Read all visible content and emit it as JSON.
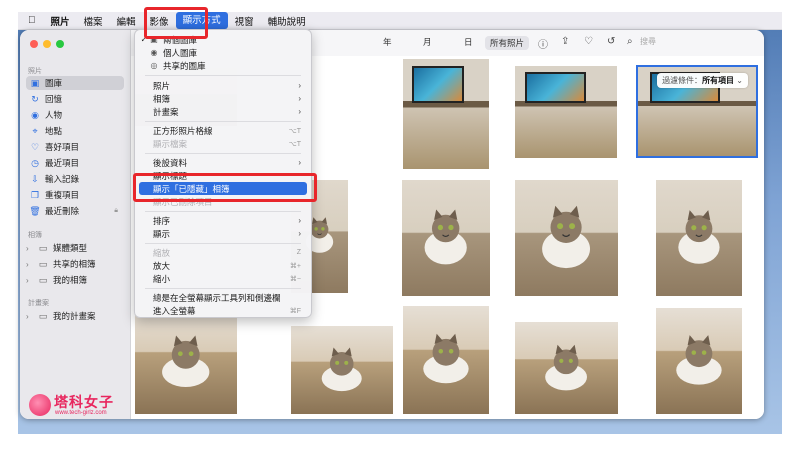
{
  "menubar": {
    "apple_icon": "apple-logo",
    "items": [
      "照片",
      "檔案",
      "編輯",
      "影像",
      "顯示方式",
      "視窗",
      "輔助說明"
    ],
    "active_item": "顯示方式"
  },
  "sidebar": {
    "section_photos": "照片",
    "items": [
      {
        "label": "圖庫",
        "icon": "library-icon"
      },
      {
        "label": "回憶",
        "icon": "memories-icon"
      },
      {
        "label": "人物",
        "icon": "people-icon"
      },
      {
        "label": "地點",
        "icon": "places-icon"
      },
      {
        "label": "喜好項目",
        "icon": "heart-icon"
      },
      {
        "label": "最近項目",
        "icon": "clock-icon"
      },
      {
        "label": "輸入記錄",
        "icon": "import-icon"
      },
      {
        "label": "重複項目",
        "icon": "duplicates-icon"
      },
      {
        "label": "最近刪除",
        "icon": "trash-icon"
      }
    ],
    "section_albums": "相簿",
    "albums": [
      {
        "label": "媒體類型"
      },
      {
        "label": "共享的相簿"
      },
      {
        "label": "我的相簿"
      }
    ],
    "section_projects": "計畫案",
    "projects": [
      {
        "label": "我的計畫案"
      }
    ]
  },
  "toolbar": {
    "segments": [
      "年",
      "月",
      "日",
      "所有照片"
    ],
    "selected_segment": "所有照片",
    "search_placeholder": "搜尋"
  },
  "filter": {
    "label": "過濾條件：",
    "value": "所有項目"
  },
  "menu": {
    "items": [
      {
        "label": "兩個圖庫",
        "check": "✓",
        "icon": "library-icon"
      },
      {
        "label": "個人圖庫",
        "icon": "person-icon"
      },
      {
        "label": "共享的圖庫",
        "icon": "people-icon"
      },
      {
        "label": "照片"
      },
      {
        "label": "相簿"
      },
      {
        "label": "計畫案"
      },
      {
        "label": "正方形照片格線",
        "shortcut": "⌥T"
      },
      {
        "label": "顯示檔案",
        "shortcut": "⌥T"
      },
      {
        "label": "後設資料"
      },
      {
        "label": "顯示標題"
      },
      {
        "label": "顯示「已隱藏」相簿"
      },
      {
        "label": "顯示已刪除項目"
      },
      {
        "label": "排序"
      },
      {
        "label": "顯示"
      },
      {
        "label": "縮放",
        "shortcut": "Z"
      },
      {
        "label": "放大",
        "shortcut": "⌘+"
      },
      {
        "label": "縮小",
        "shortcut": "⌘−"
      },
      {
        "label": "總是在全螢幕顯示工具列和側邊欄"
      },
      {
        "label": "進入全螢幕",
        "shortcut": "⌘F"
      }
    ]
  },
  "brand": {
    "name": "塔科女子",
    "url": "www.tech-girlz.com"
  },
  "colors": {
    "accent": "#2f6fe0",
    "highlight_box": "#e8262b",
    "brand": "#e8265e"
  }
}
